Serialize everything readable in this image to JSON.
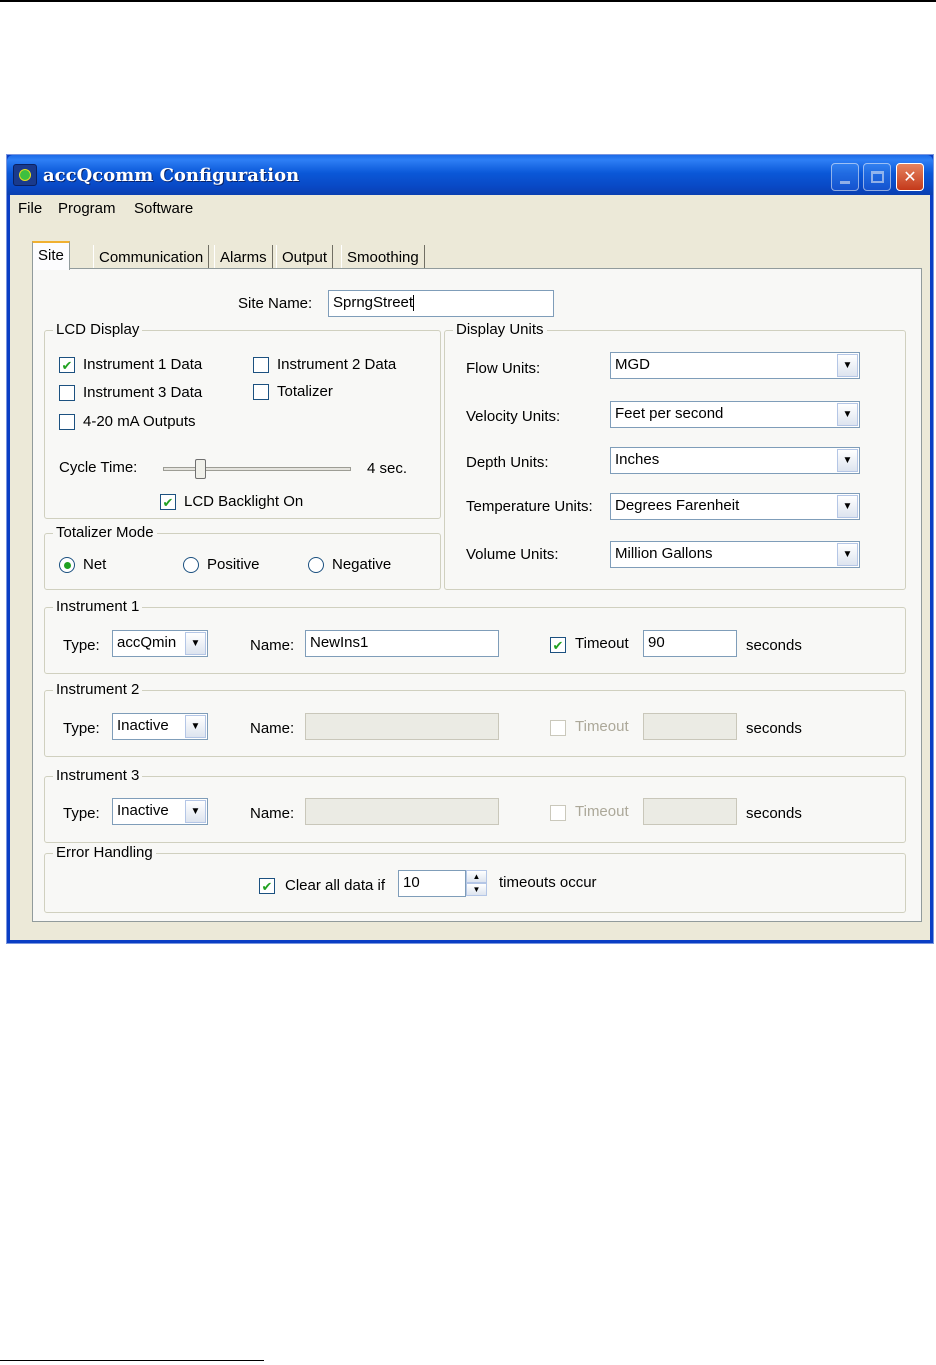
{
  "window": {
    "title": "accQcomm  Configuration",
    "controls": {
      "minimize": "_",
      "maximize": "□",
      "close": "✕"
    }
  },
  "menu": {
    "items": [
      "File",
      "Program",
      "Software"
    ]
  },
  "tabs": [
    "Site",
    "Communication",
    "Alarms",
    "Output",
    "Smoothing"
  ],
  "active_tab": "Site",
  "site": {
    "label": "Site Name:",
    "value": "SprngStreet"
  },
  "lcd_display": {
    "title": "LCD Display",
    "checkboxes": [
      {
        "label": "Instrument 1 Data",
        "checked": true
      },
      {
        "label": "Instrument 2 Data",
        "checked": false
      },
      {
        "label": "Instrument 3 Data",
        "checked": false
      },
      {
        "label": "Totalizer",
        "checked": false
      },
      {
        "label": "4-20 mA Outputs",
        "checked": false
      }
    ],
    "cycle_time_label": "Cycle Time:",
    "cycle_time_value": "4 sec.",
    "cycle_time_slider_fraction": 0.18,
    "backlight_label": "LCD Backlight On",
    "backlight_checked": true
  },
  "totalizer_mode": {
    "title": "Totalizer Mode",
    "options": [
      {
        "label": "Net",
        "selected": true
      },
      {
        "label": "Positive",
        "selected": false
      },
      {
        "label": "Negative",
        "selected": false
      }
    ]
  },
  "display_units": {
    "title": "Display Units",
    "rows": [
      {
        "label": "Flow Units:",
        "value": "MGD"
      },
      {
        "label": "Velocity Units:",
        "value": "Feet per second"
      },
      {
        "label": "Depth Units:",
        "value": "Inches"
      },
      {
        "label": "Temperature Units:",
        "value": "Degrees Farenheit"
      },
      {
        "label": "Volume Units:",
        "value": "Million Gallons"
      }
    ]
  },
  "instruments": [
    {
      "title": "Instrument 1",
      "type_label": "Type:",
      "type": "accQmin",
      "name_label": "Name:",
      "name": "NewIns1",
      "timeout_label": "Timeout",
      "timeout_checked": true,
      "timeout": "90",
      "seconds_label": "seconds",
      "enabled": true
    },
    {
      "title": "Instrument 2",
      "type_label": "Type:",
      "type": "Inactive",
      "name_label": "Name:",
      "name": "",
      "timeout_label": "Timeout",
      "timeout_checked": false,
      "timeout": "",
      "seconds_label": "seconds",
      "enabled": false
    },
    {
      "title": "Instrument 3",
      "type_label": "Type:",
      "type": "Inactive",
      "name_label": "Name:",
      "name": "",
      "timeout_label": "Timeout",
      "timeout_checked": false,
      "timeout": "",
      "seconds_label": "seconds",
      "enabled": false
    }
  ],
  "error_handling": {
    "title": "Error Handling",
    "checked": true,
    "prefix": "Clear all data if",
    "value": "10",
    "suffix": "timeouts occur"
  },
  "icons": {
    "check": "✔",
    "dropdown": "▼",
    "spin_up": "▲",
    "spin_down": "▼"
  }
}
